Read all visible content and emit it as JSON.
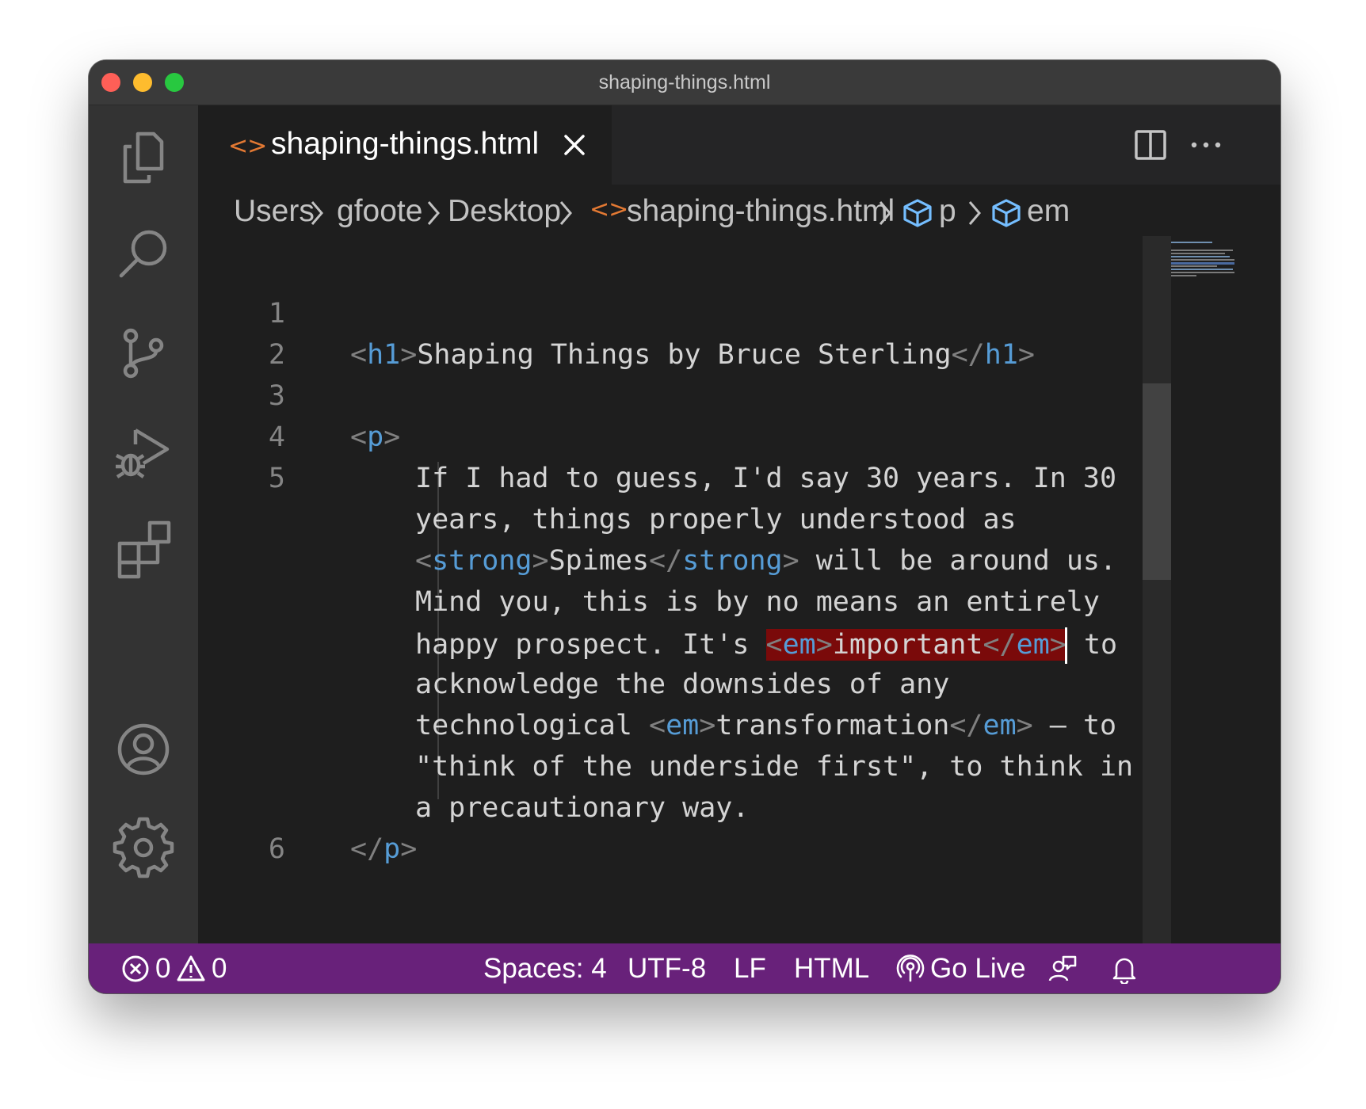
{
  "window": {
    "title": "shaping-things.html"
  },
  "activity_bar": {
    "icons": [
      "files-icon",
      "search-icon",
      "source-control-icon",
      "run-debug-icon",
      "extensions-icon",
      "account-icon",
      "settings-gear-icon"
    ]
  },
  "tab": {
    "icon_glyph": "<>",
    "label": "shaping-things.html"
  },
  "breadcrumb": {
    "items": [
      "Users",
      "gfoote",
      "Desktop",
      "shaping-things.html",
      "p",
      "em"
    ]
  },
  "editor": {
    "line_numbers": [
      "1",
      "2",
      "3",
      "4",
      "5",
      "6"
    ],
    "lines": {
      "l2": {
        "open": "h1",
        "text": "Shaping Things by Bruce Sterling",
        "close": "h1"
      },
      "l4": {
        "open": "p"
      },
      "l5": {
        "w1": "If I had to guess, I'd say 30 years. In 30",
        "w2": "years, things properly understood as",
        "w3_tag": "strong",
        "w3_text": "Spimes",
        "w3_rest": " will be around us.",
        "w4": "Mind you, this is by no means an entirely",
        "w5_pre": "happy prospect. It's ",
        "w5_tag": "em",
        "w5_text": "important",
        "w5_post": " to",
        "w6": "acknowledge the downsides of any",
        "w7_pre": "technological ",
        "w7_tag": "em",
        "w7_text": "transformation",
        "w7_post": " – to",
        "w8": "\"think of the underside first\", to think in",
        "w9": "a precautionary way."
      },
      "l6": {
        "close": "p"
      }
    }
  },
  "status_bar": {
    "errors": "0",
    "warnings": "0",
    "spaces": "Spaces: 4",
    "encoding": "UTF-8",
    "eol": "LF",
    "language": "HTML",
    "go_live": "Go Live"
  },
  "colors": {
    "status_bar": "#68217a",
    "tag_name": "#569cd6",
    "highlight": "#7a0a0a",
    "html_icon": "#e37933",
    "symbol_icon": "#75beff"
  }
}
